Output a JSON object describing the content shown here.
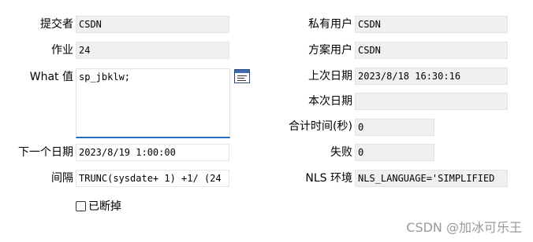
{
  "left": {
    "submitter": {
      "label": "提交者",
      "value": "CSDN"
    },
    "job": {
      "label": "作业",
      "value": "24"
    },
    "what": {
      "label": "What 值",
      "value": "sp_jbklw;"
    },
    "next_date": {
      "label": "下一个日期",
      "value": "2023/8/19 1:00:00"
    },
    "interval": {
      "label": "间隔",
      "value": "TRUNC(sysdate+ 1) +1/ (24"
    },
    "broken": {
      "label": "已断掉",
      "checked": false
    }
  },
  "right": {
    "private_user": {
      "label": "私有用户",
      "value": "CSDN"
    },
    "schema_user": {
      "label": "方案用户",
      "value": "CSDN"
    },
    "last_date": {
      "label": "上次日期",
      "value": "2023/8/18 16:30:16"
    },
    "this_date": {
      "label": "本次日期",
      "value": ""
    },
    "total_time": {
      "label": "合计时间(秒)",
      "value": "0"
    },
    "failures": {
      "label": "失败",
      "value": "0"
    },
    "nls_env": {
      "label": "NLS 环境",
      "value": "NLS_LANGUAGE='SIMPLIFIED"
    }
  },
  "icons": {
    "editor": "text-editor-icon"
  },
  "watermark": "CSDN @加冰可乐王"
}
